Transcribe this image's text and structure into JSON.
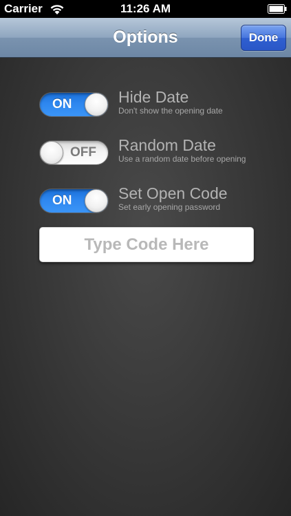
{
  "status_bar": {
    "carrier": "Carrier",
    "time": "11:26 AM",
    "icons": [
      "wifi-icon",
      "battery-icon"
    ]
  },
  "nav": {
    "title": "Options",
    "done_label": "Done",
    "accent_color": "#2f5fd0"
  },
  "options": [
    {
      "toggle_state": "ON",
      "title": "Hide Date",
      "description": "Don't show the opening date"
    },
    {
      "toggle_state": "OFF",
      "title": "Random Date",
      "description": "Use a random date before opening"
    },
    {
      "toggle_state": "ON",
      "title": "Set Open Code",
      "description": "Set early opening password"
    }
  ],
  "code_field": {
    "placeholder": "Type Code Here",
    "value": ""
  },
  "colors": {
    "toggle_on": "#2e87ef",
    "background": "#3a3a3a"
  }
}
